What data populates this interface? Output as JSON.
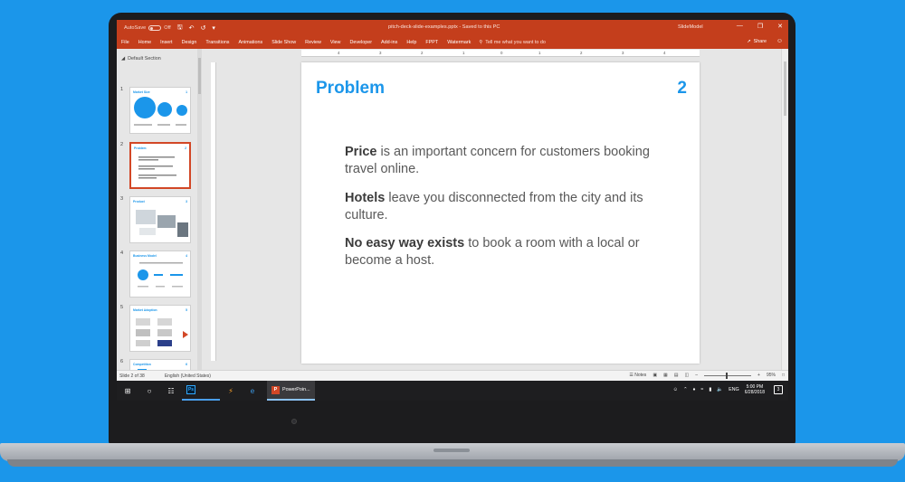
{
  "titlebar": {
    "autosave_label": "AutoSave",
    "autosave_state": "Off",
    "filename": "pitch-deck-slide-examples.pptx - Saved to this PC",
    "brand": "SlideModel"
  },
  "ribbon": {
    "tabs": [
      "File",
      "Home",
      "Insert",
      "Design",
      "Transitions",
      "Animations",
      "Slide Show",
      "Review",
      "View",
      "Developer",
      "Add-ins",
      "Help",
      "FPPT",
      "Watermark"
    ],
    "tell_me": "Tell me what you want to do",
    "share": "Share"
  },
  "panel": {
    "section_title": "Default Section",
    "thumbnails": [
      {
        "num": "1",
        "title": "Market Size",
        "slide_no": "1"
      },
      {
        "num": "2",
        "title": "Problem",
        "slide_no": "2"
      },
      {
        "num": "3",
        "title": "Product",
        "slide_no": "3"
      },
      {
        "num": "4",
        "title": "Business Model",
        "slide_no": "4"
      },
      {
        "num": "5",
        "title": "Market Adoption",
        "slide_no": "5"
      },
      {
        "num": "6",
        "title": "Competition",
        "slide_no": "6"
      }
    ]
  },
  "ruler": {
    "h_marks": [
      "4",
      "3",
      "2",
      "1",
      "0",
      "1",
      "2",
      "3",
      "4"
    ]
  },
  "slide": {
    "title": "Problem",
    "number": "2",
    "points": [
      {
        "bold": "Price",
        "rest": " is an important concern for customers booking travel online."
      },
      {
        "bold": "Hotels",
        "rest": " leave you disconnected from the city and its culture."
      },
      {
        "bold": "No easy way exists",
        "rest": " to book a room with a local or become a host."
      }
    ]
  },
  "status": {
    "slide_count": "Slide 2 of 38",
    "language": "English (United States)",
    "notes": "Notes",
    "zoom": "95%"
  },
  "taskbar": {
    "ps_label": "Ps",
    "ppt_label": "PowerPoin...",
    "language": "ENG",
    "time": "5:00 PM",
    "date": "6/28/2018",
    "notification_count": "3"
  },
  "colors": {
    "accent_blue": "#1b96ea",
    "ppt_orange": "#c43e1c",
    "selection": "#d24726"
  }
}
